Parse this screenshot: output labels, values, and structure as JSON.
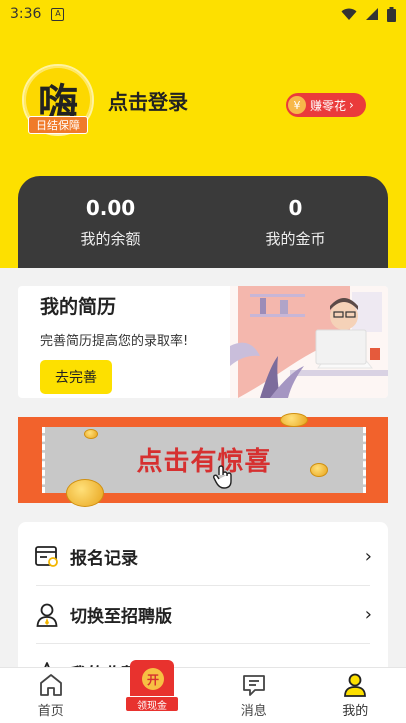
{
  "status_bar": {
    "time": "3:36",
    "a_glyph": "A"
  },
  "header": {
    "avatar_char": "嗨",
    "avatar_tag": "日结保障",
    "login_text": "点击登录",
    "earn_label": "赚零花",
    "yen_symbol": "¥",
    "chevron": "›"
  },
  "wallet": {
    "balance_value": "0.00",
    "balance_label": "我的余额",
    "coins_value": "0",
    "coins_label": "我的金币"
  },
  "resume": {
    "title": "我的简历",
    "subtitle": "完善简历提高您的录取率!",
    "button": "去完善"
  },
  "banner": {
    "text": "点击有惊喜"
  },
  "menu": {
    "items": [
      {
        "label": "报名记录",
        "icon": "registration-record-icon"
      },
      {
        "label": "切换至招聘版",
        "icon": "switch-recruiter-icon"
      },
      {
        "label": "我的收藏",
        "icon": "favorite-star-icon"
      }
    ],
    "chevron": "›"
  },
  "bottom_nav": {
    "items": [
      {
        "label": "首页",
        "icon": "home-icon"
      },
      {
        "label": "领现金",
        "icon": "red-envelope-icon",
        "badge": "开"
      },
      {
        "label": "消息",
        "icon": "message-icon"
      },
      {
        "label": "我的",
        "icon": "profile-icon"
      }
    ]
  },
  "colors": {
    "brand_yellow": "#fde000",
    "dark_panel": "#3a3a3a",
    "accent_red": "#ea3b3b",
    "banner_orange": "#f2622c"
  }
}
